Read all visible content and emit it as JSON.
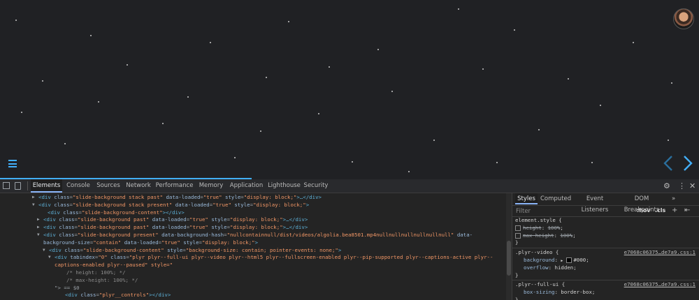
{
  "devtools": {
    "tabs": [
      "Elements",
      "Console",
      "Sources",
      "Network",
      "Performance",
      "Memory",
      "Application",
      "Lighthouse",
      "Security"
    ],
    "active_tab": "Elements",
    "more_icon": "kebab-icon"
  },
  "elements": {
    "lines": [
      {
        "tri": "▶",
        "tag_open": "<div ",
        "attrs": [
          [
            "class",
            "\"slide-background stack past\""
          ],
          [
            "data-loaded",
            "\"true\""
          ],
          [
            "style",
            "\"display: block;\""
          ]
        ],
        "tail": ">…</div>"
      },
      {
        "tri": "▼",
        "tag_open": "<div ",
        "attrs": [
          [
            "class",
            "\"slide-background stack present\""
          ],
          [
            "data-loaded",
            "\"true\""
          ],
          [
            "style",
            "\"display: block;\""
          ]
        ],
        "tail": ">"
      },
      {
        "tri": "",
        "tag_open": "<div ",
        "attrs": [
          [
            "class",
            "\"slide-background-content\""
          ]
        ],
        "tail": "></div>"
      },
      {
        "tri": "▶",
        "tag_open": "<div ",
        "attrs": [
          [
            "class",
            "\"slide-background past\""
          ],
          [
            "data-loaded",
            "\"true\""
          ],
          [
            "style",
            "\"display: block;\""
          ]
        ],
        "tail": ">…</div>"
      },
      {
        "tri": "▶",
        "tag_open": "<div ",
        "attrs": [
          [
            "class",
            "\"slide-background past\""
          ],
          [
            "data-loaded",
            "\"true\""
          ],
          [
            "style",
            "\"display: block;\""
          ]
        ],
        "tail": ">…</div>"
      },
      {
        "tri": "▼",
        "tag_open": "<div ",
        "attrs": [
          [
            "class",
            "\"slide-background present\""
          ],
          [
            "data-background-hash",
            "\"nullcontainnull/dist/videos/algolia.bea8501.mp4nullnullnullnullnullnull\""
          ],
          [
            "data-",
            ""
          ]
        ],
        "tail": ""
      },
      {
        "tri": "",
        "tag_open": "",
        "attrs": [
          [
            "background-size",
            "\"contain\""
          ],
          [
            "data-loaded",
            "\"true\""
          ],
          [
            "style",
            "\"display: block;\""
          ]
        ],
        "tail": ">"
      },
      {
        "tri": "▼",
        "tag_open": "<div ",
        "attrs": [
          [
            "class",
            "\"slide-background-content\""
          ],
          [
            "style",
            "\"background-size: contain; pointer-events: none;\""
          ]
        ],
        "tail": ">"
      },
      {
        "tri": "▼",
        "tag_open": "<div ",
        "attrs": [
          [
            "tabindex",
            "\"0\""
          ],
          [
            "class",
            "\"plyr plyr--full-ui plyr--video plyr--html5 plyr--fullscreen-enabled plyr--pip-supported plyr--captions-active plyr--"
          ]
        ],
        "tail": ""
      },
      {
        "tri": "",
        "tag_open": "",
        "attrs": [],
        "raw": "captions-enabled plyr--paused\" style=\""
      },
      {
        "tri": "",
        "tag_open": "",
        "attrs": [],
        "raw": "/* height: 100%; */"
      },
      {
        "tri": "",
        "tag_open": "",
        "attrs": [],
        "raw": "/* max-height: 100%; */"
      },
      {
        "tri": "",
        "tag_open": "",
        "attrs": [],
        "raw": "\"> == $0"
      },
      {
        "tri": "",
        "tag_open": "<div ",
        "attrs": [
          [
            "class",
            "\"plyr__controls\""
          ]
        ],
        "tail": "></div>"
      }
    ]
  },
  "styles": {
    "tabs": [
      "Styles",
      "Computed",
      "Event Listeners",
      "DOM Breakpoints"
    ],
    "active_tab": "Styles",
    "more": "»",
    "filter_placeholder": "Filter",
    "hov": ":hov",
    "cls": ".cls",
    "add": "+",
    "rules": [
      {
        "selector": "element.style {",
        "source": "",
        "props": [
          {
            "name": "height",
            "value": "100%",
            "disabled": true
          },
          {
            "name": "max-height",
            "value": "100%",
            "disabled": true
          }
        ]
      },
      {
        "selector": ".plyr--video {",
        "source": "e7068c06375…de7a9.css:1",
        "props": [
          {
            "name": "background",
            "value": "#000",
            "swatch": true
          },
          {
            "name": "overflow",
            "value": "hidden"
          }
        ]
      },
      {
        "selector": ".plyr--full-ui {",
        "source": "e7068c06375…de7a9.css:1",
        "props": [
          {
            "name": "box-sizing",
            "value": "border-box"
          }
        ]
      }
    ]
  },
  "viewport": {
    "menu_icon": "hamburger-icon",
    "prev_icon": "chevron-left-icon",
    "next_icon": "chevron-right-icon",
    "accent": "#42affa",
    "progress": 0.36
  }
}
